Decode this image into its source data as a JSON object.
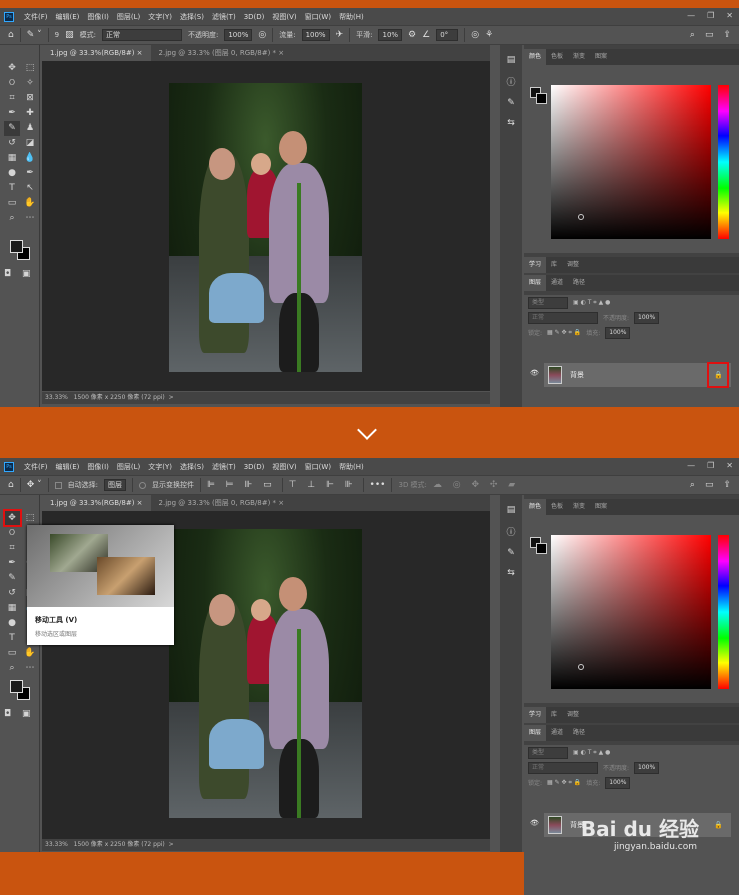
{
  "menu": [
    "文件(F)",
    "编辑(E)",
    "图像(I)",
    "图层(L)",
    "文字(Y)",
    "选择(S)",
    "滤镜(T)",
    "3D(D)",
    "视图(V)",
    "窗口(W)",
    "帮助(H)"
  ],
  "logo": "Ps",
  "window_controls": [
    "—",
    "❐",
    "✕"
  ],
  "top": {
    "options": {
      "brush_size": "9",
      "mode_label": "模式:",
      "mode_value": "正常",
      "opacity_label": "不透明度:",
      "opacity_value": "100%",
      "flow_label": "流量:",
      "flow_value": "100%",
      "smooth_label": "平滑:",
      "smooth_value": "10%",
      "angle_value": "0°"
    }
  },
  "bottom": {
    "options": {
      "auto_select_label": "自动选择:",
      "auto_select_value": "图层",
      "show_transform_label": "显示变换控件",
      "mode3d_label": "3D 模式:"
    },
    "tooltip": {
      "title": "移动工具 (V)",
      "desc": "移动选区或图层"
    }
  },
  "tabs": [
    {
      "label": "1.jpg @ 33.3%(RGB/8#)",
      "close": "×"
    },
    {
      "label": "2.jpg @ 33.3% (图层 0, RGB/8#) *",
      "close": "×"
    }
  ],
  "status": {
    "zoom": "33.33%",
    "info": "1500 像素 x 2250 像素 (72 ppi)",
    "arrow": ">"
  },
  "color_tabs": [
    "颜色",
    "色板",
    "渐变",
    "图案"
  ],
  "learn_tabs": [
    "学习",
    "库",
    "调整"
  ],
  "layer_tabs": [
    "图层",
    "通道",
    "路径"
  ],
  "layers_panel": {
    "filter_placeholder": "类型",
    "blend": "正常",
    "opacity_label": "不透明度:",
    "opacity_value": "100%",
    "lock_label": "锁定:",
    "fill_label": "填充:",
    "fill_value": "100%"
  },
  "layers": [
    {
      "name": "背景",
      "locked": true
    }
  ],
  "watermark": {
    "brand": "Bai du 经验",
    "url": "jingyan.baidu.com"
  }
}
